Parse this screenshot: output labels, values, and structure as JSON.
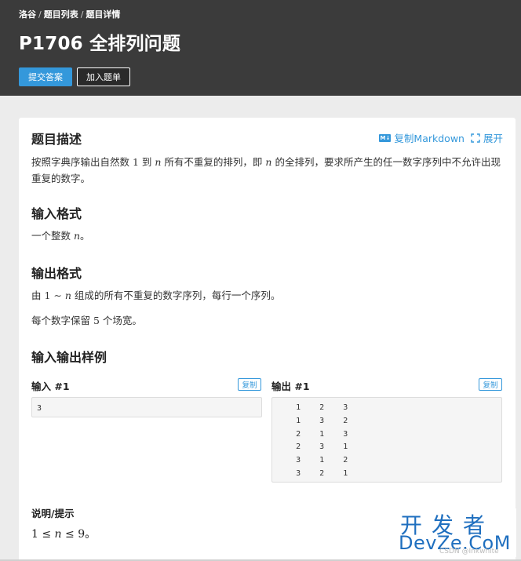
{
  "breadcrumb": [
    "洛谷",
    "题目列表",
    "题目详情"
  ],
  "breadcrumb_sep": "/",
  "problem": {
    "title": "P1706 全排列问题"
  },
  "header_buttons": {
    "submit": "提交答案",
    "add_to_list": "加入题单"
  },
  "actions": {
    "md_badge": "M↓",
    "copy_markdown": "复制Markdown",
    "expand": "展开"
  },
  "sections": {
    "description": {
      "heading": "题目描述",
      "text_parts": [
        "按照字典序输出自然数 ",
        "1",
        " 到 ",
        "n",
        " 所有不重复的排列，即 ",
        "n",
        " 的全排列，要求所产生的任一数字序列中不允许出现重复的数字。"
      ]
    },
    "input_format": {
      "heading": "输入格式",
      "text_parts": [
        "一个整数 ",
        "n",
        "。"
      ]
    },
    "output_format": {
      "heading": "输出格式",
      "line1_parts": [
        "由 ",
        "1 ∼ ",
        "n",
        " 组成的所有不重复的数字序列，每行一个序列。"
      ],
      "line2_parts": [
        "每个数字保留 ",
        "5",
        " 个场宽。"
      ]
    },
    "samples": {
      "heading": "输入输出样例",
      "input_label": "输入 #1",
      "output_label": "输出 #1",
      "copy_label": "复制",
      "input_content": "3",
      "output_content": "    1    2    3\n    1    3    2\n    2    1    3\n    2    3    1\n    3    1    2\n    3    2    1"
    },
    "hint": {
      "heading": "说明/提示",
      "parts": [
        "1 ≤ ",
        "n",
        " ≤ 9",
        "。"
      ]
    }
  },
  "watermark": {
    "top": "开发者",
    "bottom": "DevZe.CoM",
    "faint": "CSDN @Inkwhite"
  },
  "colors": {
    "header_bg": "#3b3b3b",
    "accent": "#3498db",
    "page_bg": "#ececec",
    "watermark": "#1f6fbf"
  },
  "icons": [
    "markdown-icon",
    "expand-icon"
  ]
}
